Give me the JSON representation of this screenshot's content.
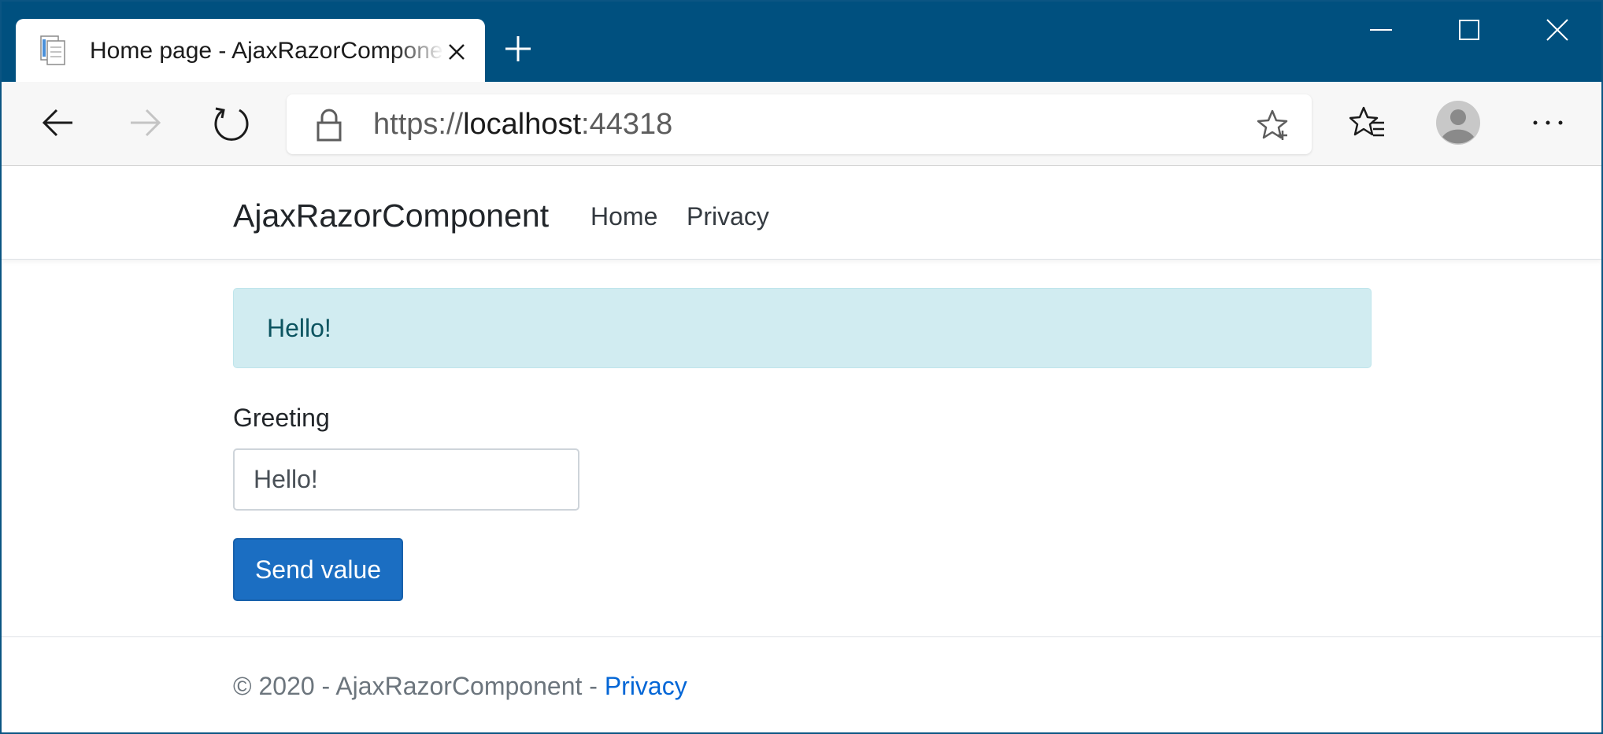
{
  "browser": {
    "tab": {
      "title": "Home page - AjaxRazorComponent",
      "favicon": "page-icon"
    },
    "new_tab_icon": "plus-icon",
    "window_controls": [
      "minimize-icon",
      "maximize-icon",
      "close-icon"
    ],
    "toolbar": {
      "back_icon": "arrow-left-icon",
      "forward_icon": "arrow-right-icon",
      "refresh_icon": "refresh-icon",
      "favorites_icon": "favorites-icon",
      "profile_icon": "avatar-icon",
      "more_icon": "ellipsis-icon"
    },
    "address": {
      "scheme": "https://",
      "host": "localhost",
      "port": ":44318",
      "lock_icon": "lock-icon",
      "star_icon": "star-add-icon"
    },
    "colors": {
      "titlebar": "#00507f",
      "toolbar": "#f7f7f7"
    }
  },
  "site": {
    "brand": "AjaxRazorComponent",
    "nav": {
      "home": "Home",
      "privacy": "Privacy"
    },
    "alert": {
      "text": "Hello!",
      "bg_color": "#d1ecf1",
      "text_color": "#0c5460"
    },
    "form": {
      "label": "Greeting",
      "input_value": "Hello!",
      "button_label": "Send value",
      "button_color": "#1b6ec2"
    },
    "footer": {
      "text": "© 2020 - AjaxRazorComponent - ",
      "link": "Privacy",
      "link_color": "#0366d6"
    }
  }
}
